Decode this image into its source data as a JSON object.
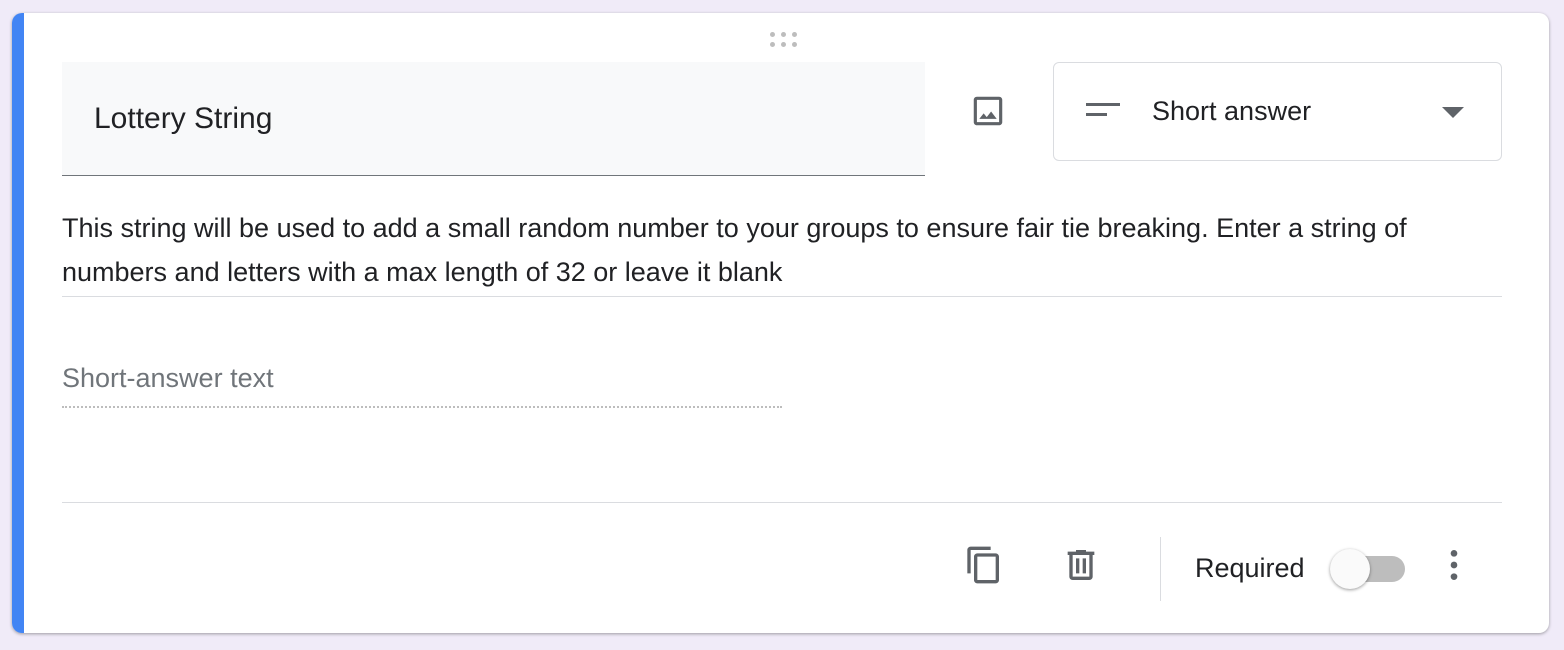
{
  "question": {
    "title": "Lottery String",
    "type_label": "Short answer",
    "description": "This string will be used to add a small random number to your groups to ensure fair tie breaking. Enter a string of numbers and letters with a max length of 32 or leave it blank",
    "answer_placeholder": "Short-answer text",
    "required_label": "Required",
    "required": false
  },
  "icons": {
    "drag": "drag-handle-icon",
    "image": "image-icon",
    "type": "short-text-icon",
    "dropdown": "arrow-drop-down-icon",
    "copy": "copy-icon",
    "delete": "trash-icon",
    "more": "more-vert-icon"
  },
  "colors": {
    "accent": "#4285f4",
    "background": "#f0ebf8",
    "card": "#ffffff",
    "icon": "#5f6368"
  }
}
